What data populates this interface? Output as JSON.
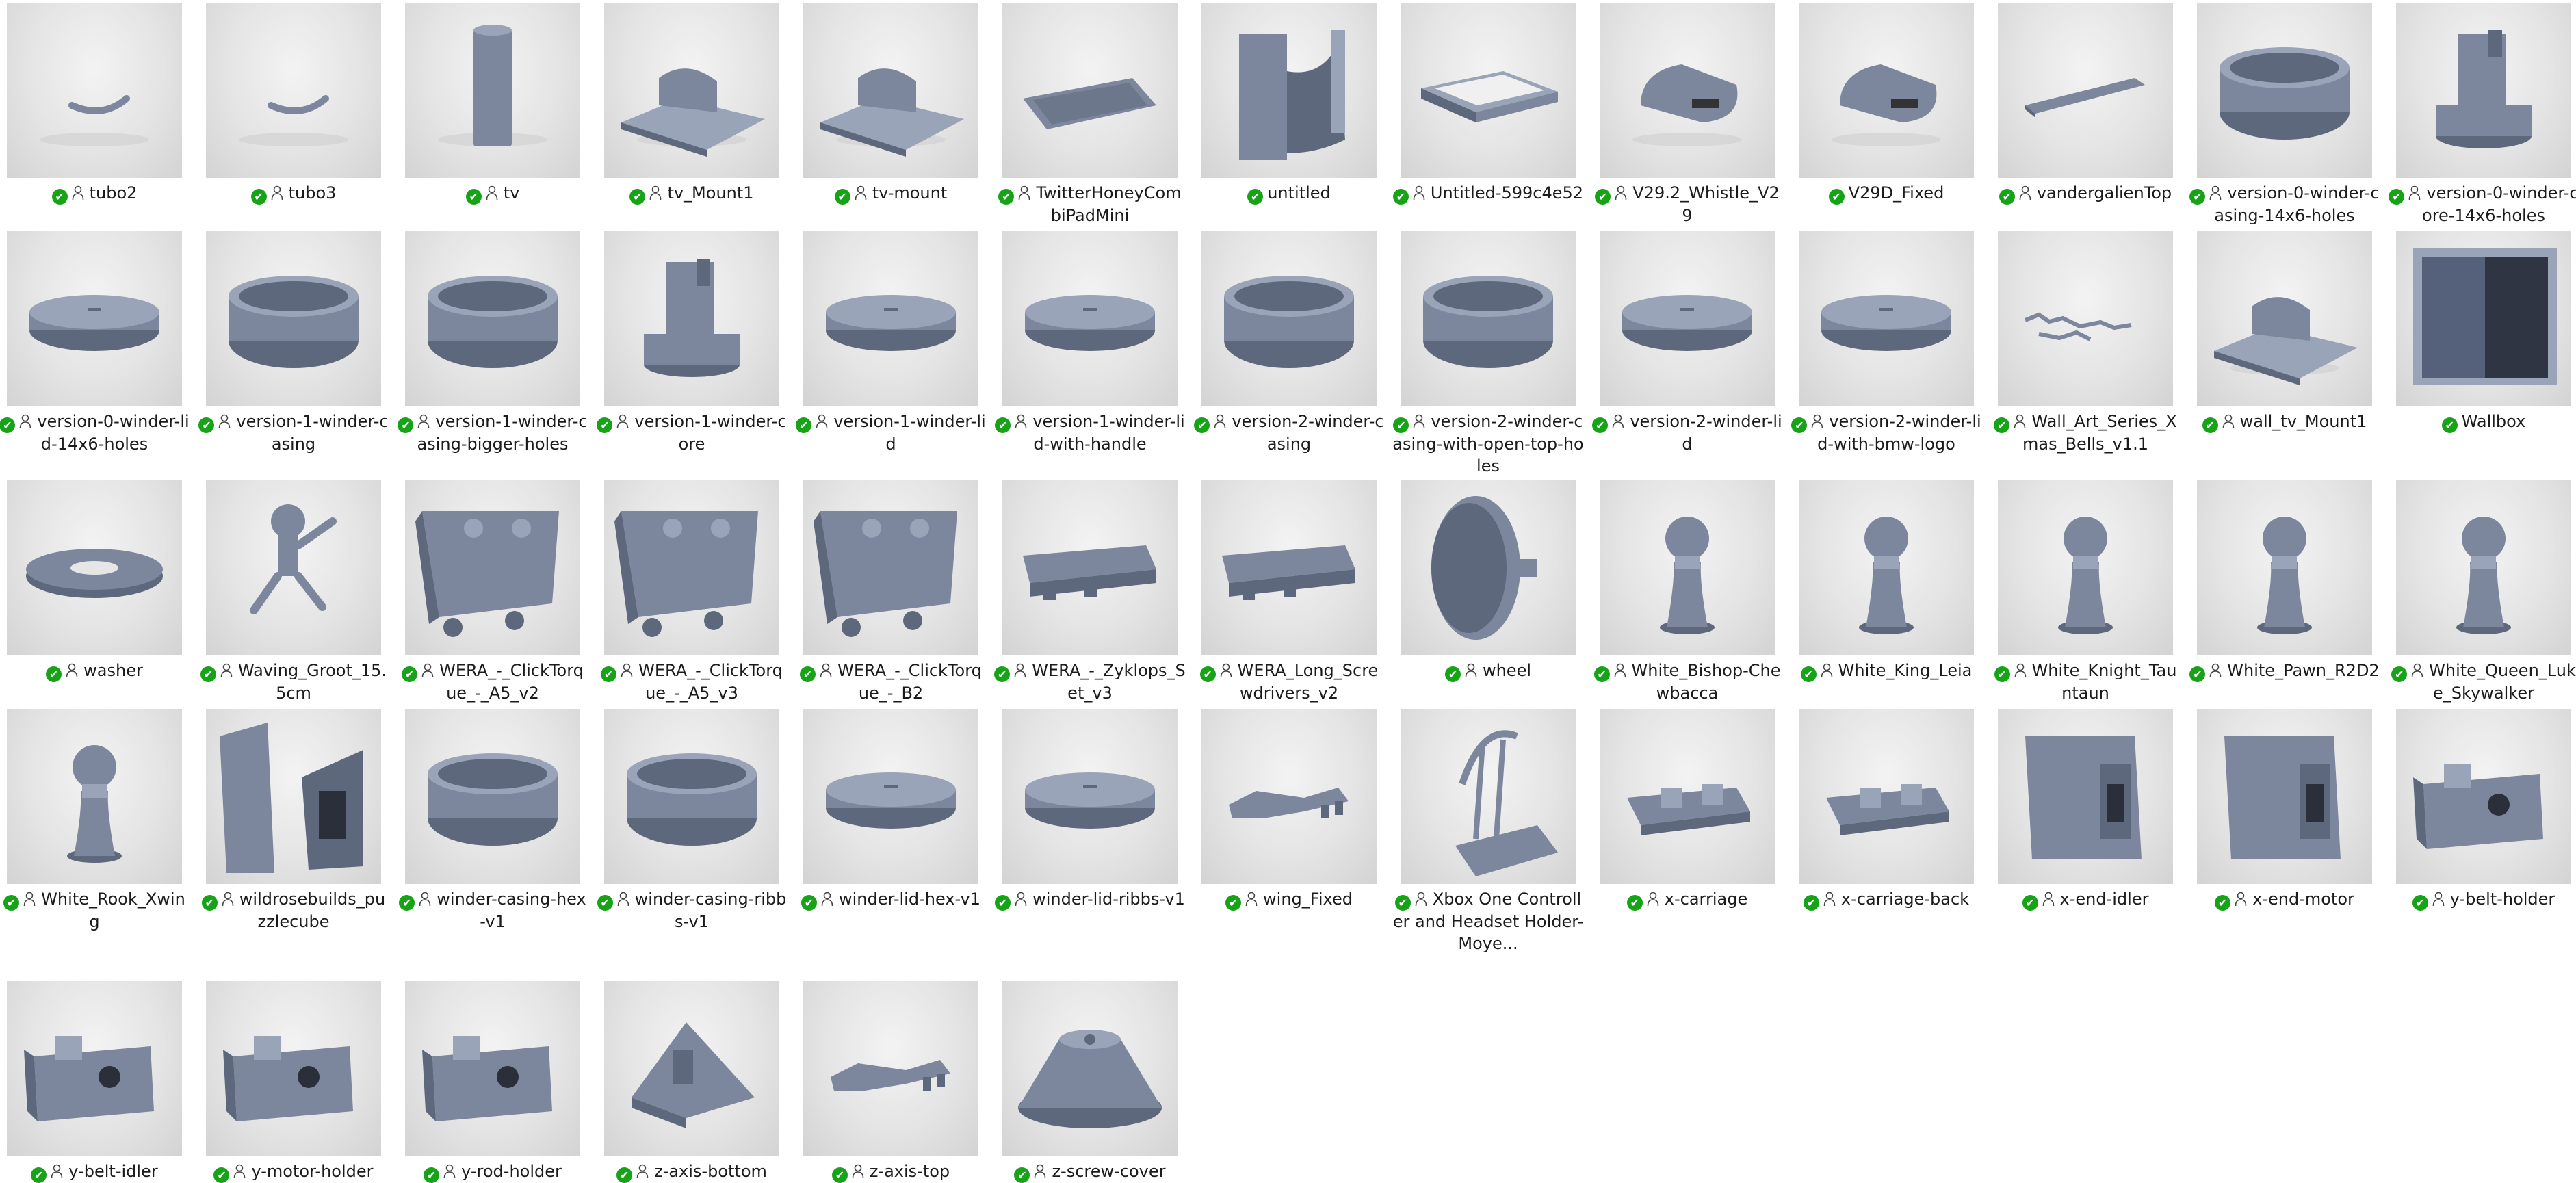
{
  "items": [
    {
      "name": "tubo2",
      "shape": "tube-curve",
      "shared": true
    },
    {
      "name": "tubo3",
      "shape": "tube-curve",
      "shared": true
    },
    {
      "name": "tv",
      "shape": "cylinder",
      "shared": true
    },
    {
      "name": "tv_Mount1",
      "shape": "mount",
      "shared": true
    },
    {
      "name": "tv-mount",
      "shape": "mount",
      "shared": true
    },
    {
      "name": "TwitterHoneyCombiPadMini",
      "shape": "tray",
      "shared": true
    },
    {
      "name": "untitled",
      "shape": "bracket",
      "shared": false
    },
    {
      "name": "Untitled-599c4e52",
      "shape": "box-open",
      "shared": true
    },
    {
      "name": "V29.2_Whistle_V29",
      "shape": "whistle",
      "shared": true
    },
    {
      "name": "V29D_Fixed",
      "shape": "whistle",
      "shared": false
    },
    {
      "name": "vandergalienTop",
      "shape": "plate",
      "shared": true
    },
    {
      "name": "version-0-winder-casing-14x6-holes",
      "shape": "ring-tall",
      "shared": true
    },
    {
      "name": "version-0-winder-core-14x6-holes",
      "shape": "core",
      "shared": true
    },
    {
      "name": "version-0-winder-lid-14x6-holes",
      "shape": "disc",
      "shared": true
    },
    {
      "name": "version-1-winder-casing",
      "shape": "ring-tall",
      "shared": true
    },
    {
      "name": "version-1-winder-casing-bigger-holes",
      "shape": "ring-tall",
      "shared": true
    },
    {
      "name": "version-1-winder-core",
      "shape": "core",
      "shared": true
    },
    {
      "name": "version-1-winder-lid",
      "shape": "disc",
      "shared": true
    },
    {
      "name": "version-1-winder-lid-with-handle",
      "shape": "disc",
      "shared": true
    },
    {
      "name": "version-2-winder-casing",
      "shape": "ring-tall",
      "shared": true
    },
    {
      "name": "version-2-winder-casing-with-open-top-holes",
      "shape": "ring-tall",
      "shared": true
    },
    {
      "name": "version-2-winder-lid",
      "shape": "disc",
      "shared": true
    },
    {
      "name": "version-2-winder-lid-with-bmw-logo",
      "shape": "disc",
      "shared": true
    },
    {
      "name": "Wall_Art_Series_Xmas_Bells_v1.1",
      "shape": "scatter",
      "shared": true
    },
    {
      "name": "wall_tv_Mount1",
      "shape": "mount",
      "shared": true
    },
    {
      "name": "Wallbox",
      "shape": "wallbox",
      "shared": false
    },
    {
      "name": "washer",
      "shape": "washer",
      "shared": true
    },
    {
      "name": "Waving_Groot_15.5cm",
      "shape": "figure",
      "shared": true
    },
    {
      "name": "WERA_-_ClickTorque_-_A5_v2",
      "shape": "block-pegs",
      "shared": true
    },
    {
      "name": "WERA_-_ClickTorque_-_A5_v3",
      "shape": "block-pegs",
      "shared": true
    },
    {
      "name": "WERA_-_ClickTorque_-_B2",
      "shape": "block-pegs",
      "shared": true
    },
    {
      "name": "WERA_-_Zyklops_Set_v3",
      "shape": "rail",
      "shared": true
    },
    {
      "name": "WERA_Long_Screwdrivers_v2",
      "shape": "rail",
      "shared": true
    },
    {
      "name": "wheel",
      "shape": "wheel",
      "shared": true
    },
    {
      "name": "White_Bishop-Chewbacca",
      "shape": "chess",
      "shared": true
    },
    {
      "name": "White_King_Leia",
      "shape": "chess",
      "shared": true
    },
    {
      "name": "White_Knight_Tauntaun",
      "shape": "chess",
      "shared": true
    },
    {
      "name": "White_Pawn_R2D2",
      "shape": "chess",
      "shared": true
    },
    {
      "name": "White_Queen_Luke_Skywalker",
      "shape": "chess",
      "shared": true
    },
    {
      "name": "White_Rook_Xwing",
      "shape": "chess",
      "shared": true
    },
    {
      "name": "wildrosebuilds_puzzlecube",
      "shape": "puzzle",
      "shared": true
    },
    {
      "name": "winder-casing-hex-v1",
      "shape": "ring-tall",
      "shared": true
    },
    {
      "name": "winder-casing-ribbs-v1",
      "shape": "ring-tall",
      "shared": true
    },
    {
      "name": "winder-lid-hex-v1",
      "shape": "disc",
      "shared": true
    },
    {
      "name": "winder-lid-ribbs-v1",
      "shape": "disc",
      "shared": true
    },
    {
      "name": "wing_Fixed",
      "shape": "clip",
      "shared": true
    },
    {
      "name": "Xbox One Controller and Headset Holder-Moye...",
      "shape": "stand",
      "shared": true
    },
    {
      "name": "x-carriage",
      "shape": "carriage",
      "shared": true
    },
    {
      "name": "x-carriage-back",
      "shape": "carriage",
      "shared": true
    },
    {
      "name": "x-end-idler",
      "shape": "xend",
      "shared": true
    },
    {
      "name": "x-end-motor",
      "shape": "xend",
      "shared": true
    },
    {
      "name": "y-belt-holder",
      "shape": "yblock",
      "shared": true
    },
    {
      "name": "y-belt-idler",
      "shape": "yblock",
      "shared": true
    },
    {
      "name": "y-motor-holder",
      "shape": "yblock",
      "shared": true
    },
    {
      "name": "y-rod-holder",
      "shape": "yblock",
      "shared": true
    },
    {
      "name": "z-axis-bottom",
      "shape": "zaxis",
      "shared": true
    },
    {
      "name": "z-axis-top",
      "shape": "clip",
      "shared": true
    },
    {
      "name": "z-screw-cover",
      "shape": "cone",
      "shared": true
    }
  ],
  "colors": {
    "model": "#7c879d",
    "model_dark": "#5e687c",
    "model_light": "#9aa4b8",
    "status": "#17a317"
  },
  "icons": {
    "status": "check-circle-icon",
    "shared": "person-icon"
  }
}
